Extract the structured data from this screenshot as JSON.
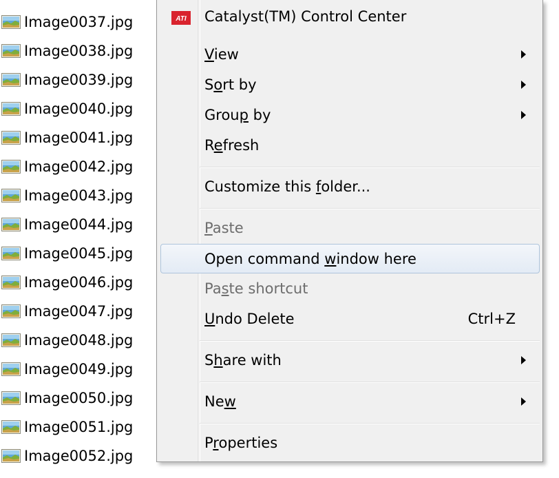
{
  "files": [
    {
      "name": "Image0037.jpg"
    },
    {
      "name": "Image0038.jpg"
    },
    {
      "name": "Image0039.jpg"
    },
    {
      "name": "Image0040.jpg"
    },
    {
      "name": "Image0041.jpg"
    },
    {
      "name": "Image0042.jpg"
    },
    {
      "name": "Image0043.jpg"
    },
    {
      "name": "Image0044.jpg"
    },
    {
      "name": "Image0045.jpg"
    },
    {
      "name": "Image0046.jpg"
    },
    {
      "name": "Image0047.jpg"
    },
    {
      "name": "Image0048.jpg"
    },
    {
      "name": "Image0049.jpg"
    },
    {
      "name": "Image0050.jpg"
    },
    {
      "name": "Image0051.jpg"
    },
    {
      "name": "Image0052.jpg"
    }
  ],
  "file_icon": "image-file-icon",
  "menu": {
    "catalyst": {
      "label": "Catalyst(TM) Control Center",
      "icon": "ati-logo-icon",
      "icon_text": "ATI"
    },
    "view": {
      "label": "View",
      "underline": "V"
    },
    "sort_by": {
      "label": "Sort by",
      "underline": "o"
    },
    "group_by": {
      "label": "Group by",
      "underline": "p"
    },
    "refresh": {
      "label": "Refresh",
      "underline": "e"
    },
    "customize": {
      "label": "Customize this folder...",
      "underline": "f"
    },
    "paste": {
      "label": "Paste",
      "underline": "P"
    },
    "open_cmd": {
      "label": "Open command window here",
      "underline": "w"
    },
    "paste_shortcut": {
      "label": "Paste shortcut",
      "underline": "s"
    },
    "undo_delete": {
      "label": "Undo Delete",
      "underline": "U",
      "shortcut": "Ctrl+Z"
    },
    "share_with": {
      "label": "Share with",
      "underline": "h"
    },
    "new": {
      "label": "New",
      "underline": "w"
    },
    "properties": {
      "label": "Properties",
      "underline": "r"
    }
  },
  "colors": {
    "menu_bg": "#f0f0f0",
    "highlight_border": "#aec4dc",
    "disabled_text": "#6d6d6d",
    "ati_red": "#d9232e"
  }
}
